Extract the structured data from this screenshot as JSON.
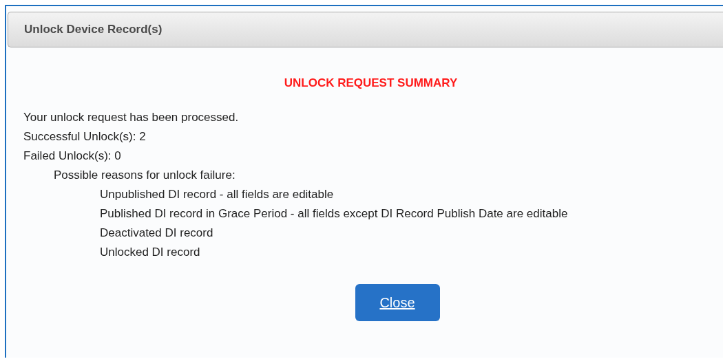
{
  "dialog": {
    "title": "Unlock Device Record(s)"
  },
  "summary": {
    "heading": "UNLOCK REQUEST SUMMARY",
    "lines": [
      "Your unlock request has been processed.",
      "Successful Unlock(s): 2",
      "Failed Unlock(s): 0"
    ],
    "reasons_heading": "Possible reasons for unlock failure:",
    "reasons": [
      "Unpublished DI record - all fields are editable",
      "Published DI record in Grace Period - all fields except DI Record Publish Date are editable",
      "Deactivated DI record",
      "Unlocked DI record"
    ]
  },
  "buttons": [
    {
      "label": "Close"
    }
  ]
}
